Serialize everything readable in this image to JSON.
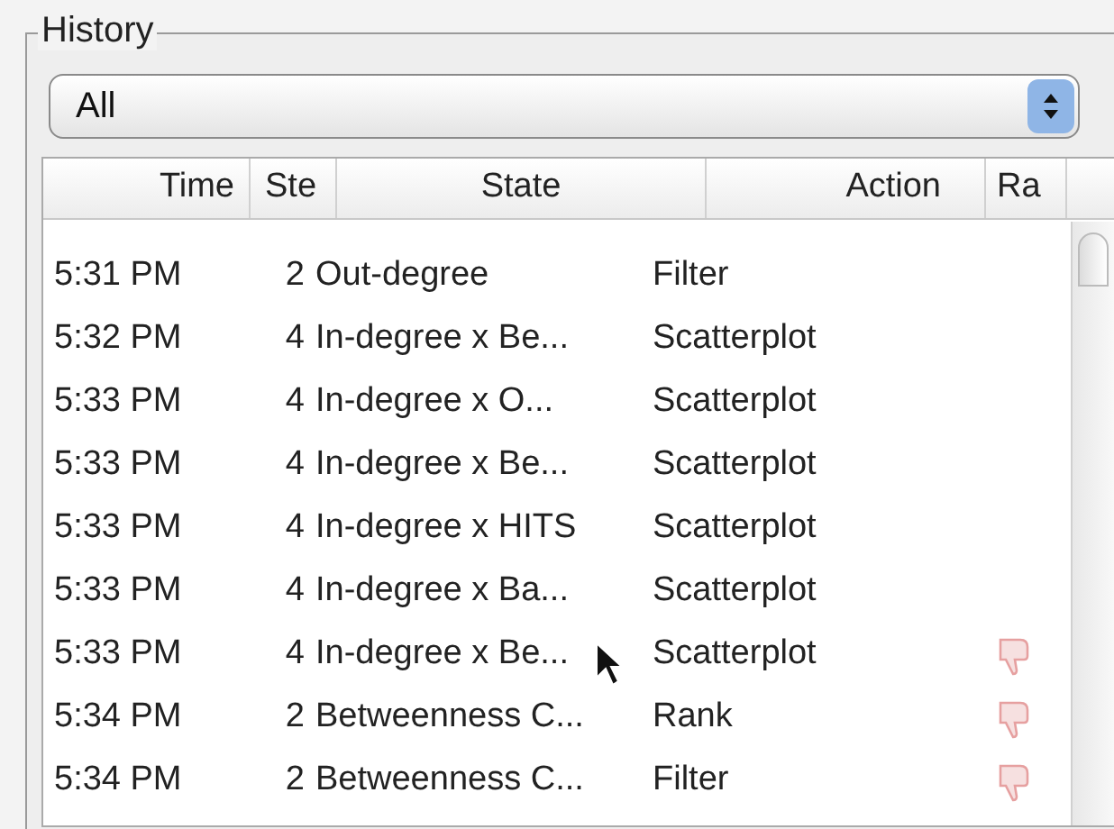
{
  "group": {
    "title": "History"
  },
  "filter": {
    "value": "All"
  },
  "table": {
    "columns": [
      "Time",
      "Ste",
      "State",
      "Action",
      "Ra"
    ],
    "rows": [
      {
        "time": "5:31 PM",
        "step": "2",
        "state": "Out-degree",
        "action": "Filter",
        "thumbs_down": false
      },
      {
        "time": "5:32 PM",
        "step": "4",
        "state": "In-degree x Be...",
        "action": "Scatterplot",
        "thumbs_down": false
      },
      {
        "time": "5:33 PM",
        "step": "4",
        "state": "In-degree x O...",
        "action": "Scatterplot",
        "thumbs_down": false
      },
      {
        "time": "5:33 PM",
        "step": "4",
        "state": "In-degree x Be...",
        "action": "Scatterplot",
        "thumbs_down": false
      },
      {
        "time": "5:33 PM",
        "step": "4",
        "state": "In-degree x HITS",
        "action": "Scatterplot",
        "thumbs_down": false
      },
      {
        "time": "5:33 PM",
        "step": "4",
        "state": "In-degree x Ba...",
        "action": "Scatterplot",
        "thumbs_down": false
      },
      {
        "time": "5:33 PM",
        "step": "4",
        "state": "In-degree x Be...",
        "action": "Scatterplot",
        "thumbs_down": true
      },
      {
        "time": "5:34 PM",
        "step": "2",
        "state": "Betweenness C...",
        "action": "Rank",
        "thumbs_down": true
      },
      {
        "time": "5:34 PM",
        "step": "2",
        "state": "Betweenness C...",
        "action": "Filter",
        "thumbs_down": true
      }
    ]
  }
}
